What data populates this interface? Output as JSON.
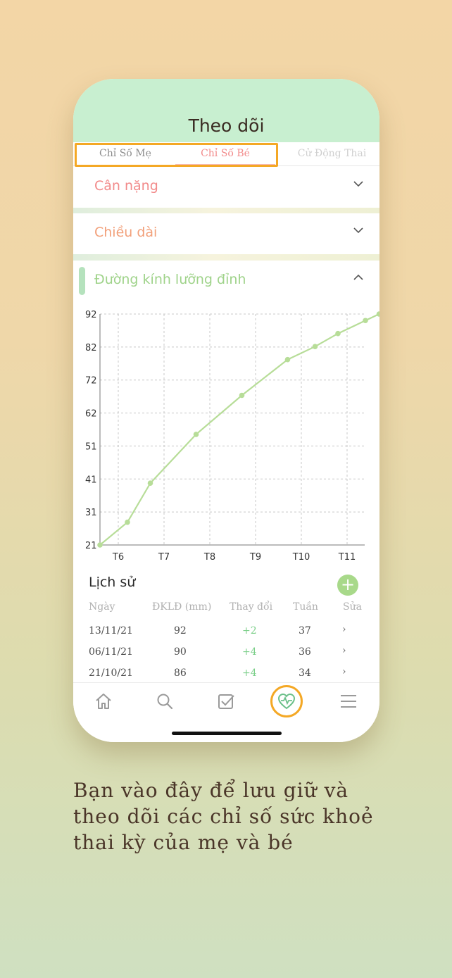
{
  "header": {
    "title": "Theo dõi"
  },
  "tabs": [
    {
      "label": "Chỉ Số Mẹ"
    },
    {
      "label": "Chỉ Số Bé"
    },
    {
      "label": "Cử Động Thai"
    }
  ],
  "sections": {
    "weight": {
      "label": "Cân nặng",
      "color": "#f28b8b"
    },
    "length": {
      "label": "Chiều dài",
      "color": "#f2a07a"
    },
    "bpd": {
      "label": "Đường kính lưỡng đỉnh",
      "color": "#9fd38a"
    }
  },
  "chart_data": {
    "type": "line",
    "x": [
      1,
      2,
      3,
      4,
      5,
      6,
      7,
      8,
      9,
      10,
      11,
      12
    ],
    "y": [
      21,
      28,
      40,
      55,
      67,
      78,
      82,
      86,
      90,
      92
    ],
    "x_positions_weeks": [
      0,
      0.6,
      1.1,
      2.1,
      3.1,
      4.1,
      4.7,
      5.2,
      5.8,
      6.1
    ],
    "xticks": [
      "T6",
      "T7",
      "T8",
      "T9",
      "T10",
      "T11"
    ],
    "yticks": [
      21,
      31,
      41,
      51,
      62,
      72,
      82,
      92
    ],
    "ylim": [
      21,
      92
    ],
    "grid": true,
    "line_color": "#b7dd98"
  },
  "history": {
    "title": "Lịch sử",
    "add_label": "+",
    "columns": [
      "Ngày",
      "ĐKLĐ (mm)",
      "Thay đổi",
      "Tuần",
      "Sửa"
    ],
    "rows": [
      {
        "date": "13/11/21",
        "value": "92",
        "change": "+2",
        "week": "37",
        "edit": "›"
      },
      {
        "date": "06/11/21",
        "value": "90",
        "change": "+4",
        "week": "36",
        "edit": "›"
      },
      {
        "date": "21/10/21",
        "value": "86",
        "change": "+4",
        "week": "34",
        "edit": "›"
      }
    ]
  },
  "nav": [
    {
      "icon": "home-icon"
    },
    {
      "icon": "search-icon"
    },
    {
      "icon": "checkbox-icon"
    },
    {
      "icon": "heart-pulse-icon"
    },
    {
      "icon": "menu-icon"
    }
  ],
  "caption": "Bạn vào đây để lưu giữ và theo dõi các chỉ số sức khoẻ thai kỳ của mẹ và bé"
}
